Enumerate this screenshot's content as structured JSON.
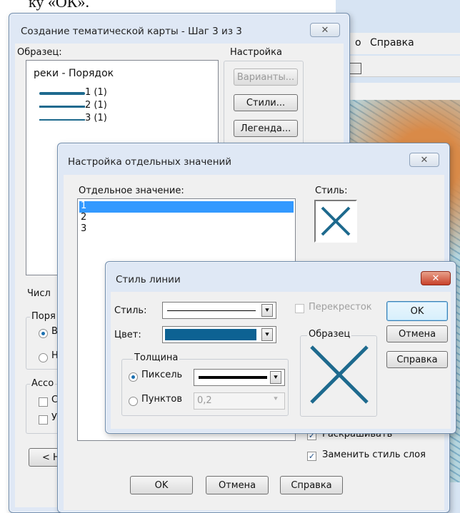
{
  "caption_fragment": "ку «ОК».",
  "background_app": {
    "menu": [
      "о",
      "Справка"
    ]
  },
  "wizard": {
    "title": "Создание тематической карты - Шаг 3 из 3",
    "sample_label": "Образец:",
    "sample_layer": "реки - Порядок",
    "legend_items": [
      "1 (1)",
      "2 (1)",
      "3 (1)"
    ],
    "settings_group": "Настройка",
    "variants_button": "Варианты...",
    "styles_button": "Стили...",
    "legend_button": "Легенда...",
    "count_label": "Числ",
    "order_group": "Поря",
    "order_option_1": "В",
    "order_option_2": "Н",
    "assoc_group": "Ассо",
    "assoc_option_1": "С",
    "assoc_option_2": "У",
    "back_button": "< На",
    "line_color": "#1e6a8e"
  },
  "values_dialog": {
    "title": "Настройка отдельных значений",
    "value_label": "Отдельное значение:",
    "style_label": "Стиль:",
    "values": [
      "1",
      "2",
      "3"
    ],
    "selected_value": "1",
    "colorize_label": "Раскрашивать",
    "replace_style_label": "Заменить стиль слоя",
    "ok_button": "OK",
    "cancel_button": "Отмена",
    "help_button": "Справка",
    "selection_color": "#3399ff"
  },
  "line_style_dialog": {
    "title": "Стиль линии",
    "style_label": "Стиль:",
    "color_label": "Цвет:",
    "thickness_group": "Толщина",
    "pixel_option": "Пиксель",
    "points_option": "Пунктов",
    "points_value": "0,2",
    "crossover_label": "Перекресток",
    "sample_group": "Образец",
    "ok_button": "OK",
    "cancel_button": "Отмена",
    "help_button": "Справка",
    "color_value": "#0d6293"
  }
}
